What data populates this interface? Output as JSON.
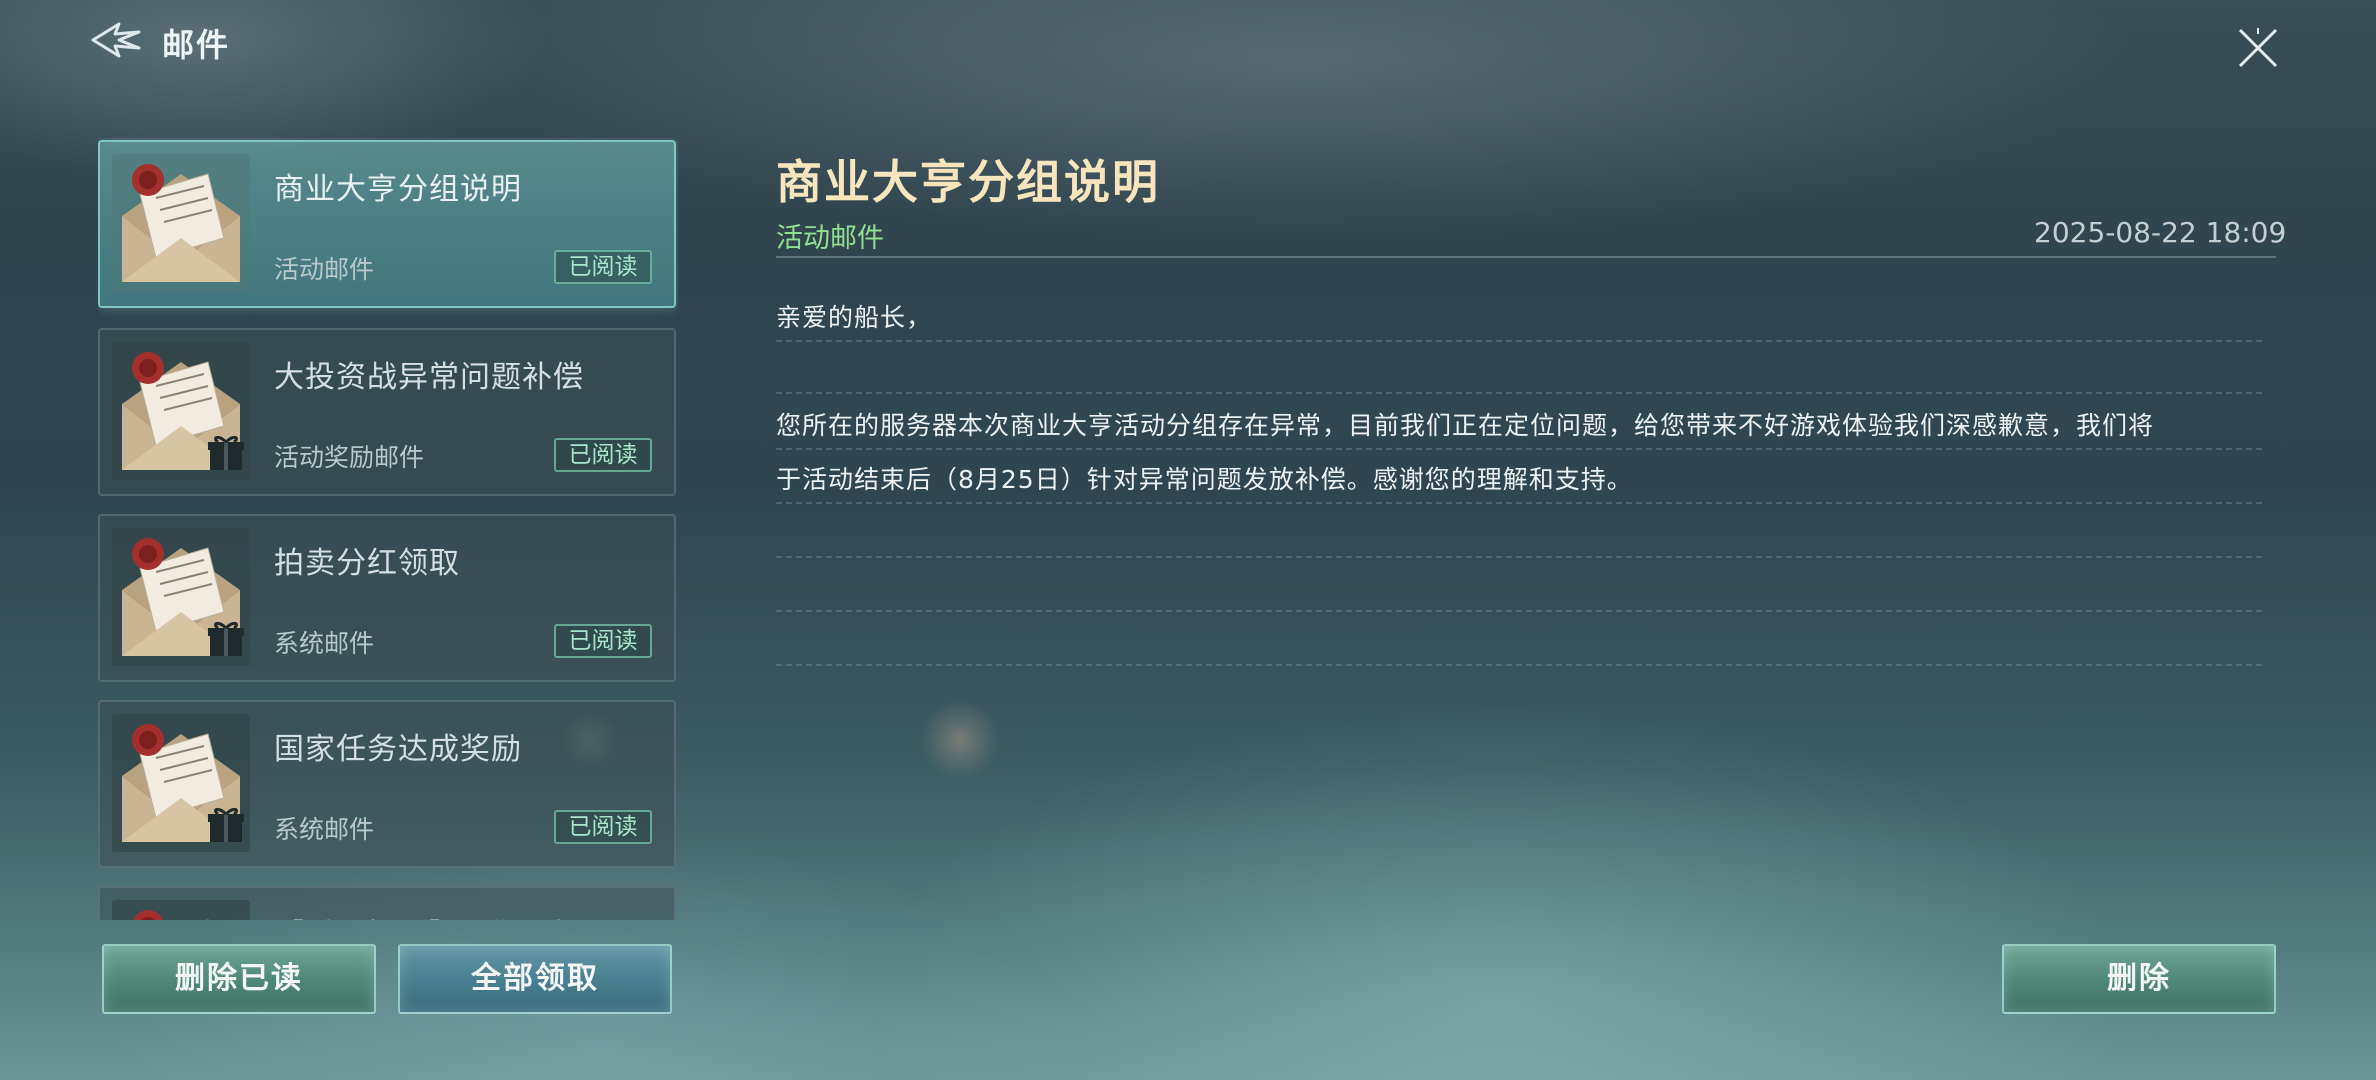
{
  "header": {
    "title": "邮件",
    "back_icon": "back-arrow-icon",
    "close_icon": "close-icon"
  },
  "mails": [
    {
      "title": "商业大亨分组说明",
      "type": "活动邮件",
      "status": "已阅读",
      "has_gift": false,
      "selected": true
    },
    {
      "title": "大投资战异常问题补偿",
      "type": "活动奖励邮件",
      "status": "已阅读",
      "has_gift": true,
      "selected": false
    },
    {
      "title": "拍卖分红领取",
      "type": "系统邮件",
      "status": "已阅读",
      "has_gift": true,
      "selected": false
    },
    {
      "title": "国家任务达成奖励",
      "type": "系统邮件",
      "status": "已阅读",
      "has_gift": true,
      "selected": false
    },
    {
      "title": "【重已提问】到期通知",
      "type": "",
      "status": "",
      "has_gift": false,
      "selected": false
    }
  ],
  "actions": {
    "delete_read": "删除已读",
    "claim_all": "全部领取",
    "delete": "删除"
  },
  "detail": {
    "title": "商业大亨分组说明",
    "category": "活动邮件",
    "date": "2025-08-22 18:09",
    "greeting": "亲爱的船长，",
    "line1": "您所在的服务器本次商业大亨活动分组存在异常，目前我们正在定位问题，给您带来不好游戏体验我们深感歉意，我们将",
    "line2": "于活动结束后（8月25日）针对异常问题发放补偿。感谢您的理解和支持。"
  },
  "colors": {
    "title_gold": "#f7e6bd",
    "category_green": "#8fe08f",
    "badge_green": "#a8e6c8"
  }
}
